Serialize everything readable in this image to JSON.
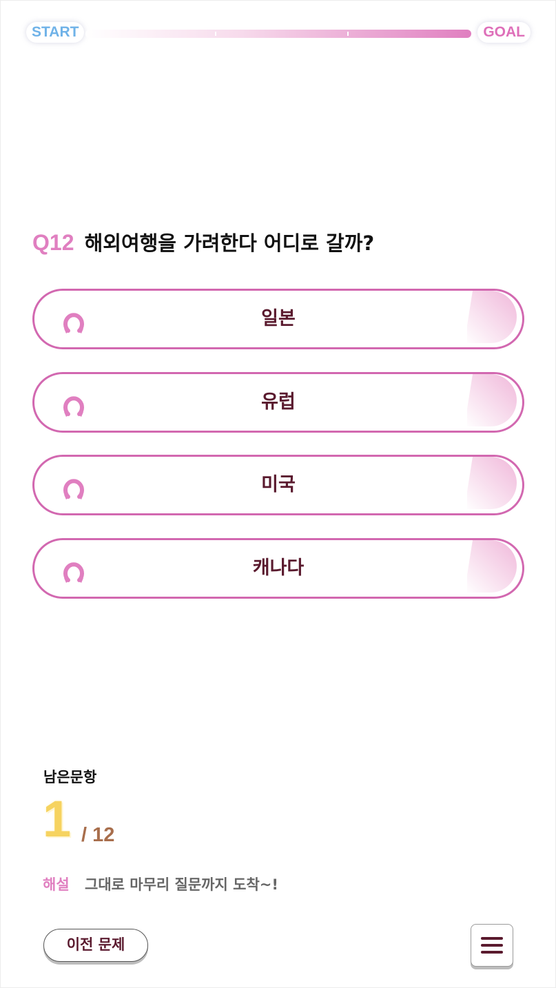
{
  "progress": {
    "start_label": "START",
    "goal_label": "GOAL",
    "fraction": 1.0
  },
  "question": {
    "number": "Q12",
    "text": "해외여행을 가려한다 어디로 갈까?"
  },
  "options": [
    {
      "label": "일본"
    },
    {
      "label": "유럽"
    },
    {
      "label": "미국"
    },
    {
      "label": "캐나다"
    }
  ],
  "remaining": {
    "label": "남은문항",
    "count": "1",
    "total": "/ 12"
  },
  "explanation": {
    "title": "해설",
    "text": "그대로 마무리 질문까지 도착~!"
  },
  "buttons": {
    "prev_label": "이전 문제"
  },
  "icons": {
    "option_icon": "horseshoe-icon",
    "menu_icon": "hamburger-menu-icon"
  },
  "colors": {
    "accent_pink": "#d268b0",
    "label_maroon": "#5a1a2e",
    "count_yellow": "#f6d360",
    "total_brown": "#a86e4c",
    "start_blue": "#6fb2e8"
  }
}
